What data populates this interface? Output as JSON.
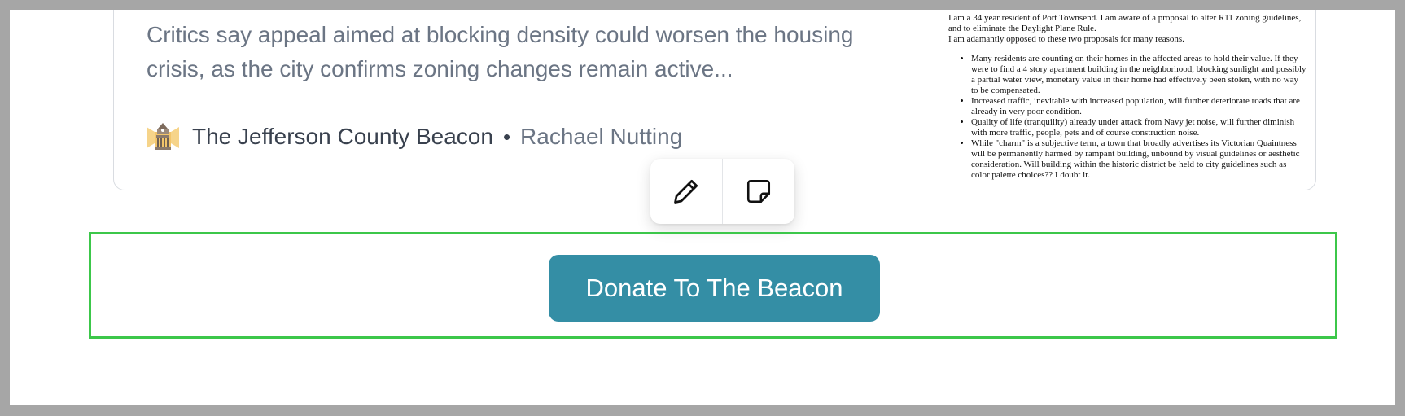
{
  "article": {
    "excerpt": "Critics say appeal aimed at blocking density could worsen the housing crisis, as the city confirms zoning changes remain active...",
    "publication": "The Jefferson County Beacon",
    "separator": "•",
    "author": "Rachael Nutting",
    "publication_logo": "courthouse-logo-icon"
  },
  "document_thumbnail": {
    "intro": [
      "I am a 34 year resident of Port Townsend. I am aware of a proposal to alter R11 zoning guidelines, and to eliminate the Daylight Plane Rule.",
      "I am adamantly opposed to these two proposals for many reasons."
    ],
    "bullets": [
      "Many residents are counting on their homes in the affected areas to hold their value. If they were to find a 4 story apartment building in the neighborhood, blocking sunlight and possibly a partial water view, monetary value in their home had effectively been stolen, with no way to be compensated.",
      "Increased traffic, inevitable with increased population, will further deteriorate roads that are already in very poor condition.",
      "Quality of life (tranquility) already under attack from Navy jet noise, will further diminish with more traffic, people, pets and of course construction noise.",
      "While \"charm\" is a subjective term, a town that broadly advertises its Victorian Quaintness will be permanently harmed by rampant building, unbound by visual guidelines or aesthetic consideration. Will building within the historic district be held to city guidelines such as color palette choices?? I doubt it."
    ]
  },
  "toolbar": {
    "edit_icon": "pencil-icon",
    "note_icon": "sticky-note-icon"
  },
  "donate": {
    "label": "Donate To The Beacon",
    "color": "#348ea5"
  },
  "highlight_color": "#3cc74a"
}
